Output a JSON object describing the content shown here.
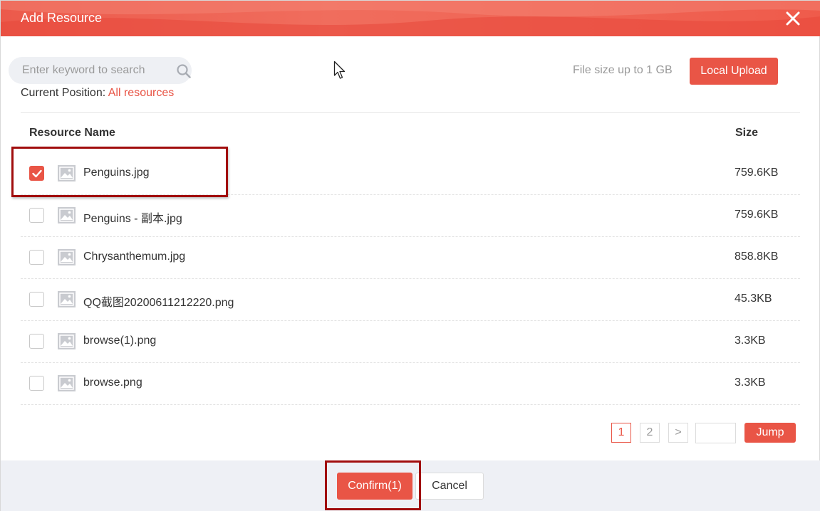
{
  "dialog": {
    "title": "Add Resource",
    "close_icon": "close-icon"
  },
  "search": {
    "placeholder": "Enter keyword to search",
    "value": "",
    "icon": "search-icon"
  },
  "position": {
    "label": "Current Position:",
    "link": "All resources"
  },
  "upload": {
    "limit_text": "File size up to 1 GB",
    "button_label": "Local Upload"
  },
  "table": {
    "headers": {
      "name": "Resource Name",
      "size": "Size"
    },
    "rows": [
      {
        "name": "Penguins.jpg",
        "size": "759.6KB",
        "checked": true,
        "icon": "image-icon"
      },
      {
        "name": "Penguins - 副本.jpg",
        "size": "759.6KB",
        "checked": false,
        "icon": "image-icon"
      },
      {
        "name": "Chrysanthemum.jpg",
        "size": "858.8KB",
        "checked": false,
        "icon": "image-icon"
      },
      {
        "name": "QQ截图20200611212220.png",
        "size": "45.3KB",
        "checked": false,
        "icon": "image-icon"
      },
      {
        "name": "browse(1).png",
        "size": "3.3KB",
        "checked": false,
        "icon": "image-icon"
      },
      {
        "name": "browse.png",
        "size": "3.3KB",
        "checked": false,
        "icon": "image-icon"
      }
    ]
  },
  "pagination": {
    "pages": [
      "1",
      "2"
    ],
    "current": "1",
    "next": ">",
    "jump_value": "",
    "jump_label": "Jump"
  },
  "footer": {
    "confirm_label": "Confirm(1)",
    "cancel_label": "Cancel"
  },
  "colors": {
    "accent": "#e95546",
    "header": "#ec5a4b",
    "highlight_box": "#a10d0d",
    "footer_bg": "#eef0f5"
  }
}
